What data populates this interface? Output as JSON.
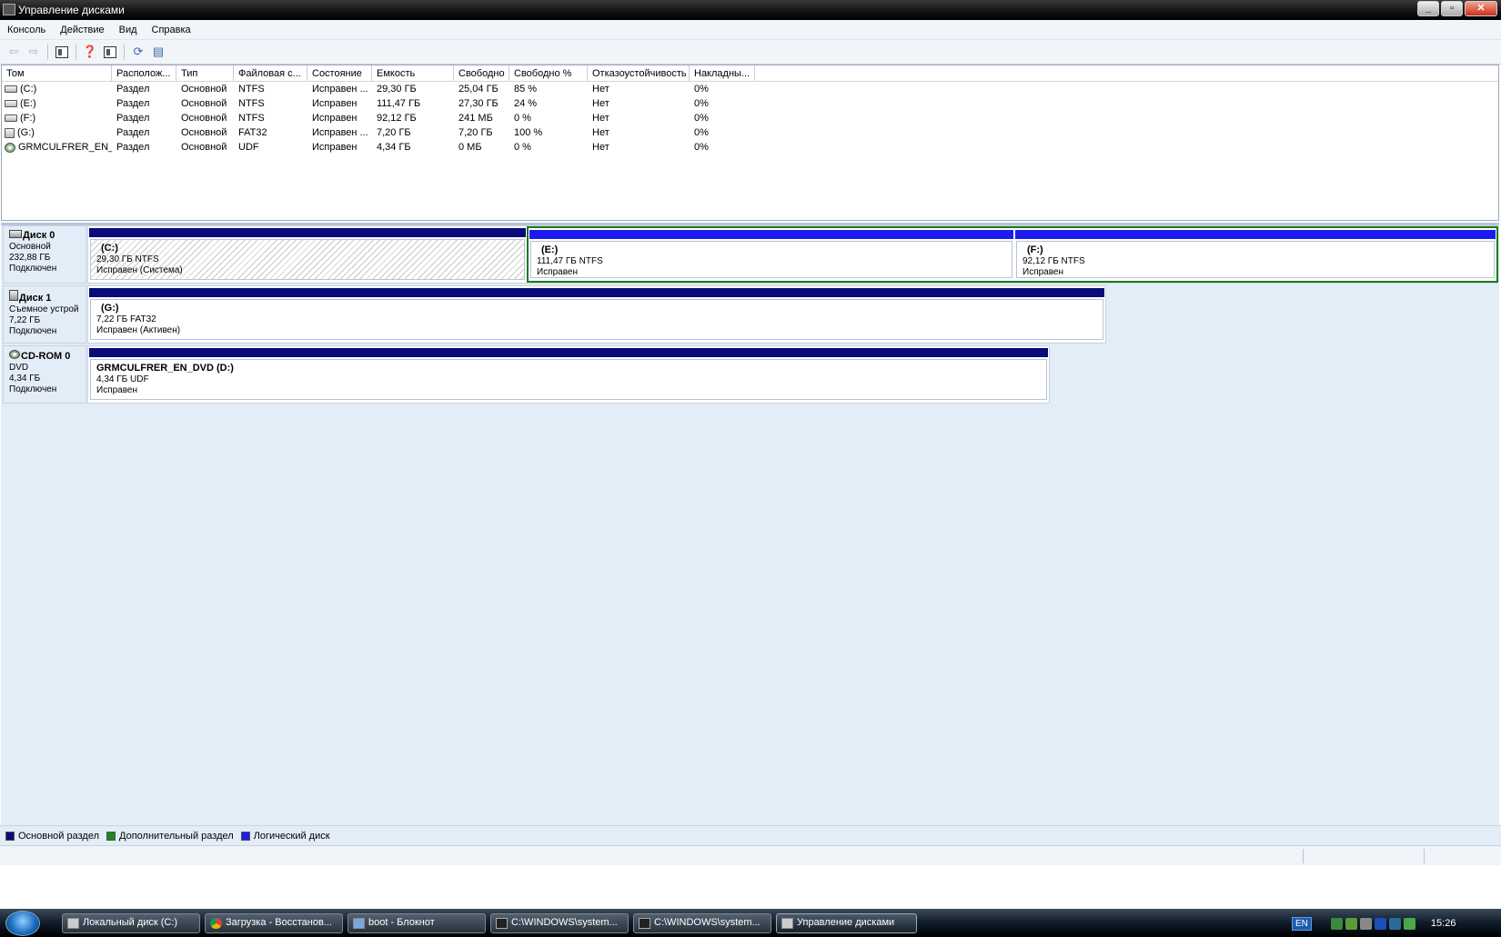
{
  "window": {
    "title": "Управление дисками"
  },
  "menu": [
    "Консоль",
    "Действие",
    "Вид",
    "Справка"
  ],
  "toolbar": {
    "icons": [
      "back-arrow-icon",
      "forward-arrow-icon",
      "show-hide-tree-icon",
      "help-properties-icon",
      "show-action-pane-icon",
      "refresh-icon",
      "export-list-icon"
    ]
  },
  "columns": [
    "Том",
    "Располож...",
    "Тип",
    "Файловая с...",
    "Состояние",
    "Емкость",
    "Свободно",
    "Свободно %",
    "Отказоустойчивость",
    "Накладны..."
  ],
  "volumes": [
    {
      "name": "(C:)",
      "layout": "Раздел",
      "type": "Основной",
      "fs": "NTFS",
      "status": "Исправен ...",
      "capacity": "29,30 ГБ",
      "free": "25,04 ГБ",
      "free_pct": "85 %",
      "fault": "Нет",
      "overhead": "0%",
      "icon": "hdd"
    },
    {
      "name": "(E:)",
      "layout": "Раздел",
      "type": "Основной",
      "fs": "NTFS",
      "status": "Исправен",
      "capacity": "111,47 ГБ",
      "free": "27,30 ГБ",
      "free_pct": "24 %",
      "fault": "Нет",
      "overhead": "0%",
      "icon": "hdd"
    },
    {
      "name": "(F:)",
      "layout": "Раздел",
      "type": "Основной",
      "fs": "NTFS",
      "status": "Исправен",
      "capacity": "92,12 ГБ",
      "free": "241 МБ",
      "free_pct": "0 %",
      "fault": "Нет",
      "overhead": "0%",
      "icon": "hdd"
    },
    {
      "name": "(G:)",
      "layout": "Раздел",
      "type": "Основной",
      "fs": "FAT32",
      "status": "Исправен ...",
      "capacity": "7,20 ГБ",
      "free": "7,20 ГБ",
      "free_pct": "100 %",
      "fault": "Нет",
      "overhead": "0%",
      "icon": "usb"
    },
    {
      "name": "GRMCULFRER_EN_...",
      "layout": "Раздел",
      "type": "Основной",
      "fs": "UDF",
      "status": "Исправен",
      "capacity": "4,34 ГБ",
      "free": "0 МБ",
      "free_pct": "0 %",
      "fault": "Нет",
      "overhead": "0%",
      "icon": "cd"
    }
  ],
  "disks": {
    "disk0": {
      "name": "Диск 0",
      "type": "Основной",
      "size": "232,88 ГБ",
      "status": "Подключен",
      "parts": [
        {
          "label": "(C:)",
          "info": "29,30 ГБ NTFS",
          "status": "Исправен (Система)"
        },
        {
          "label": "(E:)",
          "info": "111,47 ГБ NTFS",
          "status": "Исправен"
        },
        {
          "label": "(F:)",
          "info": "92,12 ГБ NTFS",
          "status": "Исправен"
        }
      ]
    },
    "disk1": {
      "name": "Диск 1",
      "type": "Съемное устрой",
      "size": "7,22 ГБ",
      "status": "Подключен",
      "parts": [
        {
          "label": "(G:)",
          "info": "7,22 ГБ FAT32",
          "status": "Исправен (Активен)"
        }
      ]
    },
    "cdrom0": {
      "name": "CD-ROM 0",
      "type": "DVD",
      "size": "4,34 ГБ",
      "status": "Подключен",
      "parts": [
        {
          "label": "GRMCULFRER_EN_DVD  (D:)",
          "info": "4,34 ГБ UDF",
          "status": "Исправен"
        }
      ]
    }
  },
  "legend": [
    {
      "label": "Основной раздел",
      "color": "#0a0a78"
    },
    {
      "label": "Дополнительный раздел",
      "color": "#1a8a1a"
    },
    {
      "label": "Логический диск",
      "color": "#1c1cf0"
    }
  ],
  "colors": {
    "primary_partition": "#0a0a78",
    "logical_drive": "#1c1cf0",
    "extended_partition": "#1a8a1a"
  },
  "taskbar": {
    "tasks": [
      "Локальный диск (C:)",
      "Загрузка - Восстанов...",
      "boot - Блокнот",
      "C:\\WINDOWS\\system...",
      "C:\\WINDOWS\\system...",
      "Управление дисками"
    ],
    "lang": "EN",
    "clock": "15:26"
  }
}
